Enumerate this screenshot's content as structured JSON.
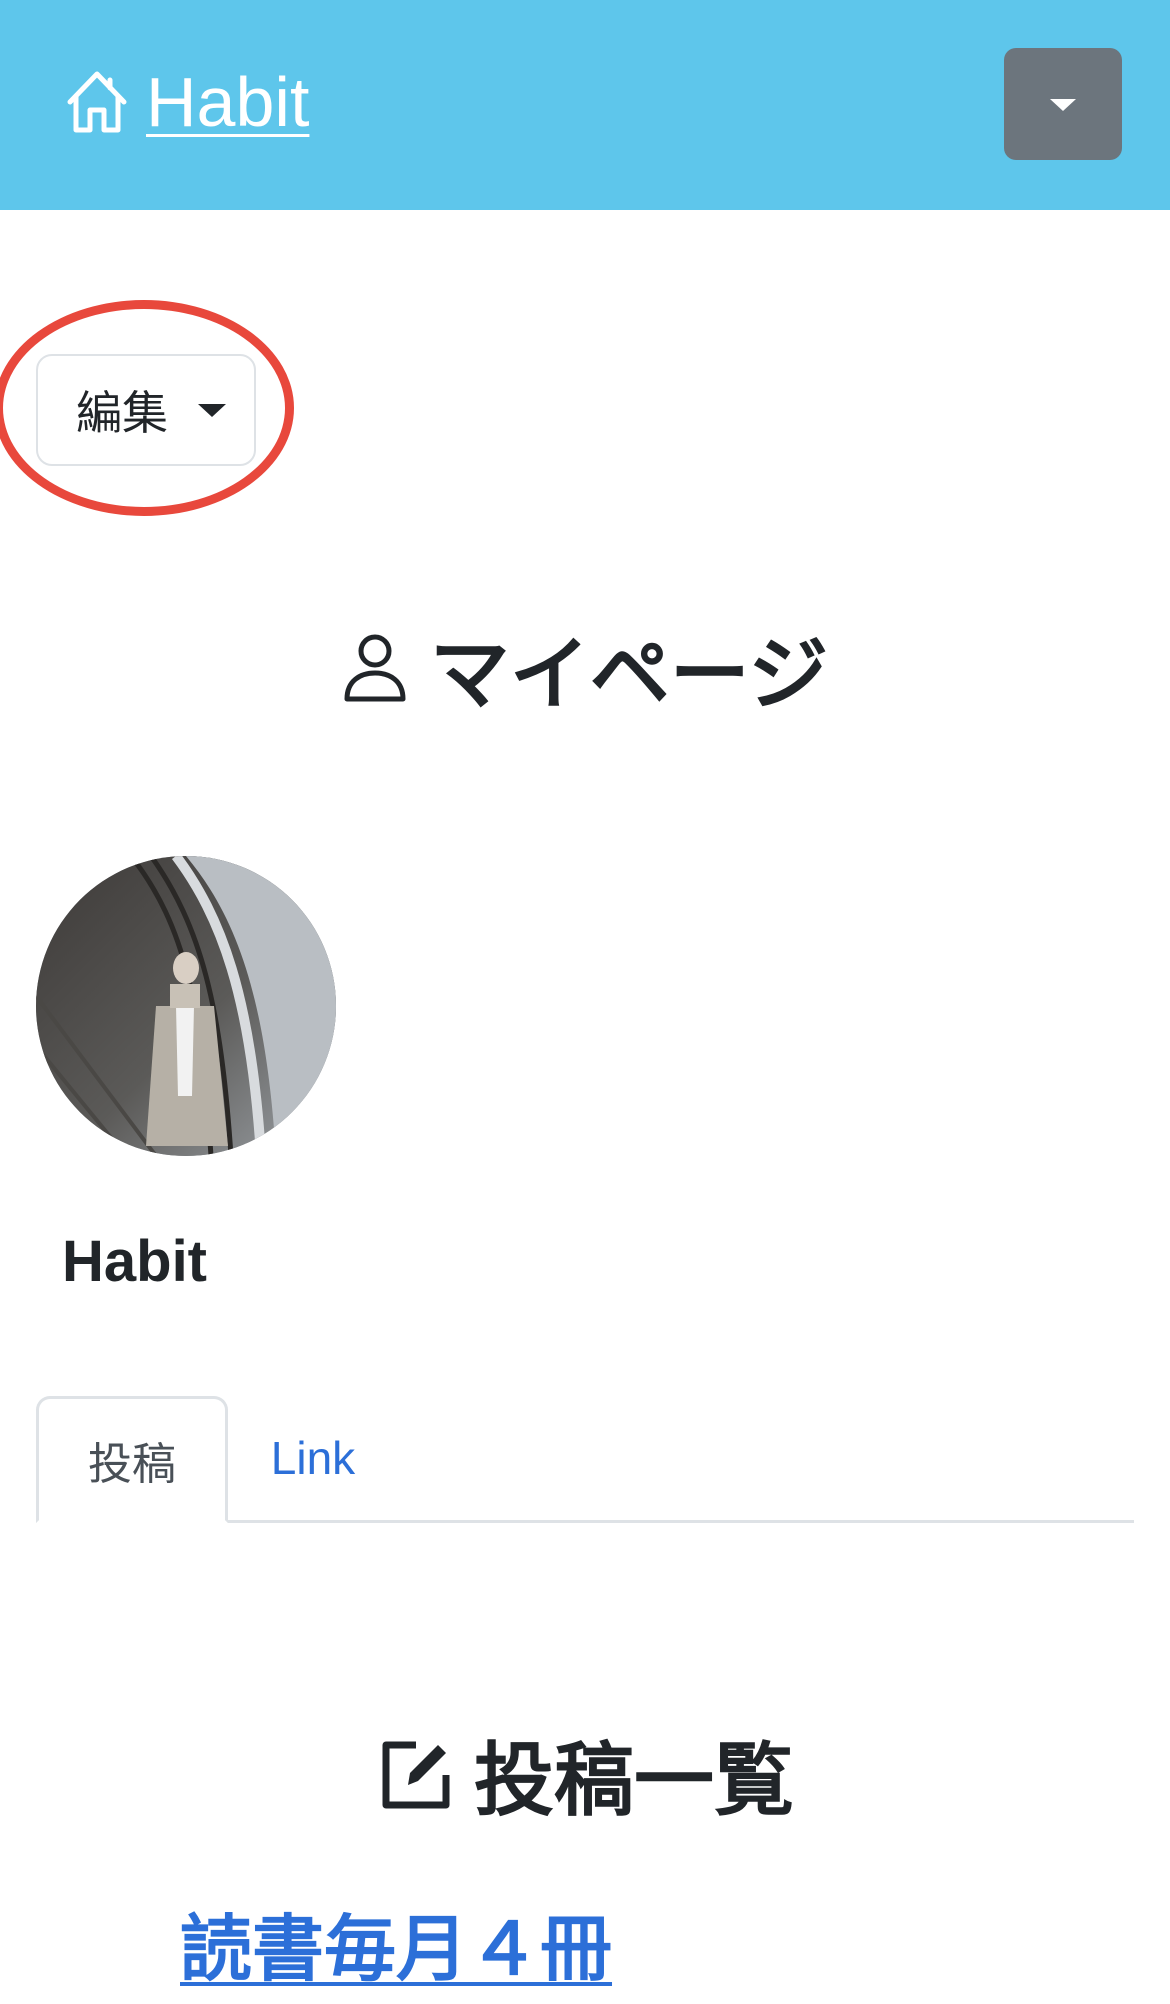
{
  "navbar": {
    "brand_label": "Habit",
    "brand_icon": "home-icon",
    "toggle_icon": "caret-down-icon",
    "background_color": "#5ec6eb",
    "toggle_color": "#6c757d"
  },
  "edit_menu": {
    "label": "編集",
    "icon": "caret-down-icon",
    "highlight_color": "#e8483c"
  },
  "page": {
    "title": "マイページ",
    "title_icon": "person-icon"
  },
  "profile": {
    "username": "Habit",
    "avatar": "avatar-photo"
  },
  "tabs": [
    {
      "label": "投稿",
      "active": true
    },
    {
      "label": "Link",
      "active": false
    }
  ],
  "posts": {
    "heading": "投稿一覧",
    "heading_icon": "edit-square-icon",
    "items": [
      {
        "title": "読書毎月４冊"
      }
    ],
    "link_color": "#2c6fd8"
  }
}
